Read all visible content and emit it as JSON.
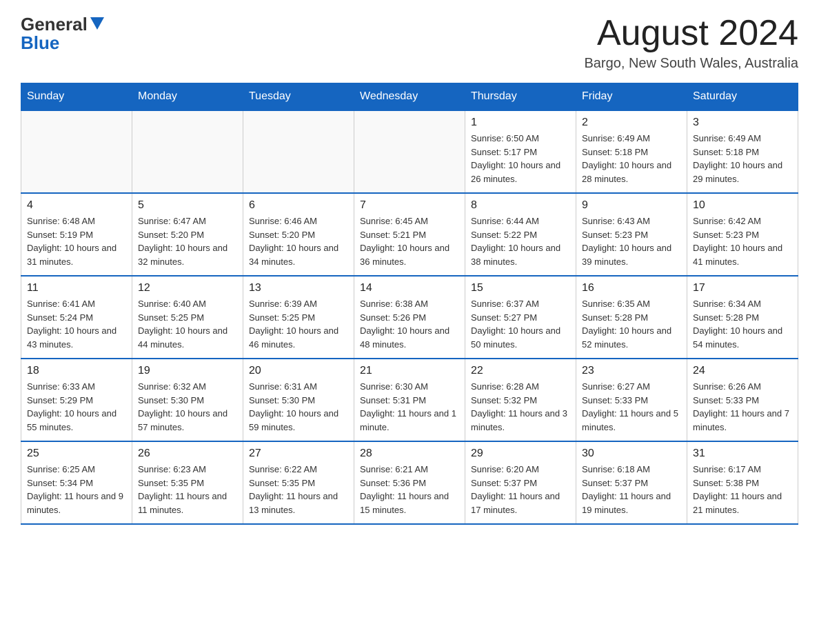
{
  "header": {
    "logo_general": "General",
    "logo_blue": "Blue",
    "month_title": "August 2024",
    "location": "Bargo, New South Wales, Australia"
  },
  "calendar": {
    "days_of_week": [
      "Sunday",
      "Monday",
      "Tuesday",
      "Wednesday",
      "Thursday",
      "Friday",
      "Saturday"
    ],
    "weeks": [
      [
        {
          "day": "",
          "info": ""
        },
        {
          "day": "",
          "info": ""
        },
        {
          "day": "",
          "info": ""
        },
        {
          "day": "",
          "info": ""
        },
        {
          "day": "1",
          "info": "Sunrise: 6:50 AM\nSunset: 5:17 PM\nDaylight: 10 hours and 26 minutes."
        },
        {
          "day": "2",
          "info": "Sunrise: 6:49 AM\nSunset: 5:18 PM\nDaylight: 10 hours and 28 minutes."
        },
        {
          "day": "3",
          "info": "Sunrise: 6:49 AM\nSunset: 5:18 PM\nDaylight: 10 hours and 29 minutes."
        }
      ],
      [
        {
          "day": "4",
          "info": "Sunrise: 6:48 AM\nSunset: 5:19 PM\nDaylight: 10 hours and 31 minutes."
        },
        {
          "day": "5",
          "info": "Sunrise: 6:47 AM\nSunset: 5:20 PM\nDaylight: 10 hours and 32 minutes."
        },
        {
          "day": "6",
          "info": "Sunrise: 6:46 AM\nSunset: 5:20 PM\nDaylight: 10 hours and 34 minutes."
        },
        {
          "day": "7",
          "info": "Sunrise: 6:45 AM\nSunset: 5:21 PM\nDaylight: 10 hours and 36 minutes."
        },
        {
          "day": "8",
          "info": "Sunrise: 6:44 AM\nSunset: 5:22 PM\nDaylight: 10 hours and 38 minutes."
        },
        {
          "day": "9",
          "info": "Sunrise: 6:43 AM\nSunset: 5:23 PM\nDaylight: 10 hours and 39 minutes."
        },
        {
          "day": "10",
          "info": "Sunrise: 6:42 AM\nSunset: 5:23 PM\nDaylight: 10 hours and 41 minutes."
        }
      ],
      [
        {
          "day": "11",
          "info": "Sunrise: 6:41 AM\nSunset: 5:24 PM\nDaylight: 10 hours and 43 minutes."
        },
        {
          "day": "12",
          "info": "Sunrise: 6:40 AM\nSunset: 5:25 PM\nDaylight: 10 hours and 44 minutes."
        },
        {
          "day": "13",
          "info": "Sunrise: 6:39 AM\nSunset: 5:25 PM\nDaylight: 10 hours and 46 minutes."
        },
        {
          "day": "14",
          "info": "Sunrise: 6:38 AM\nSunset: 5:26 PM\nDaylight: 10 hours and 48 minutes."
        },
        {
          "day": "15",
          "info": "Sunrise: 6:37 AM\nSunset: 5:27 PM\nDaylight: 10 hours and 50 minutes."
        },
        {
          "day": "16",
          "info": "Sunrise: 6:35 AM\nSunset: 5:28 PM\nDaylight: 10 hours and 52 minutes."
        },
        {
          "day": "17",
          "info": "Sunrise: 6:34 AM\nSunset: 5:28 PM\nDaylight: 10 hours and 54 minutes."
        }
      ],
      [
        {
          "day": "18",
          "info": "Sunrise: 6:33 AM\nSunset: 5:29 PM\nDaylight: 10 hours and 55 minutes."
        },
        {
          "day": "19",
          "info": "Sunrise: 6:32 AM\nSunset: 5:30 PM\nDaylight: 10 hours and 57 minutes."
        },
        {
          "day": "20",
          "info": "Sunrise: 6:31 AM\nSunset: 5:30 PM\nDaylight: 10 hours and 59 minutes."
        },
        {
          "day": "21",
          "info": "Sunrise: 6:30 AM\nSunset: 5:31 PM\nDaylight: 11 hours and 1 minute."
        },
        {
          "day": "22",
          "info": "Sunrise: 6:28 AM\nSunset: 5:32 PM\nDaylight: 11 hours and 3 minutes."
        },
        {
          "day": "23",
          "info": "Sunrise: 6:27 AM\nSunset: 5:33 PM\nDaylight: 11 hours and 5 minutes."
        },
        {
          "day": "24",
          "info": "Sunrise: 6:26 AM\nSunset: 5:33 PM\nDaylight: 11 hours and 7 minutes."
        }
      ],
      [
        {
          "day": "25",
          "info": "Sunrise: 6:25 AM\nSunset: 5:34 PM\nDaylight: 11 hours and 9 minutes."
        },
        {
          "day": "26",
          "info": "Sunrise: 6:23 AM\nSunset: 5:35 PM\nDaylight: 11 hours and 11 minutes."
        },
        {
          "day": "27",
          "info": "Sunrise: 6:22 AM\nSunset: 5:35 PM\nDaylight: 11 hours and 13 minutes."
        },
        {
          "day": "28",
          "info": "Sunrise: 6:21 AM\nSunset: 5:36 PM\nDaylight: 11 hours and 15 minutes."
        },
        {
          "day": "29",
          "info": "Sunrise: 6:20 AM\nSunset: 5:37 PM\nDaylight: 11 hours and 17 minutes."
        },
        {
          "day": "30",
          "info": "Sunrise: 6:18 AM\nSunset: 5:37 PM\nDaylight: 11 hours and 19 minutes."
        },
        {
          "day": "31",
          "info": "Sunrise: 6:17 AM\nSunset: 5:38 PM\nDaylight: 11 hours and 21 minutes."
        }
      ]
    ]
  }
}
